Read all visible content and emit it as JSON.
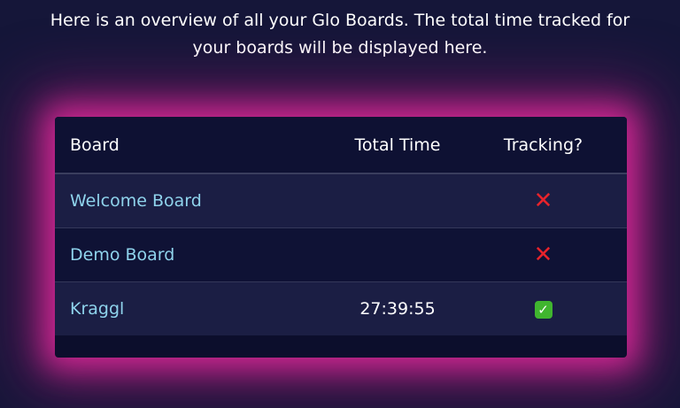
{
  "intro_text": "Here is an overview of all your Glo Boards. The total time tracked for your boards will be displayed here.",
  "table": {
    "headers": {
      "board": "Board",
      "total_time": "Total Time",
      "tracking": "Tracking?"
    },
    "rows": [
      {
        "board": "Welcome Board",
        "total_time": "",
        "tracking": false,
        "tracking_icon": "cross-mark-icon",
        "tracking_glyph": "✕"
      },
      {
        "board": "Demo Board",
        "total_time": "",
        "tracking": false,
        "tracking_icon": "cross-mark-icon",
        "tracking_glyph": "✕"
      },
      {
        "board": "Kraggl",
        "total_time": "27:39:55",
        "tracking": true,
        "tracking_icon": "check-mark-icon",
        "tracking_glyph": "✓"
      }
    ]
  },
  "colors": {
    "background": "#151639",
    "glow": "#d62896",
    "link": "#8fd3ec",
    "cross": "#e8232b",
    "check": "#40b52f"
  }
}
